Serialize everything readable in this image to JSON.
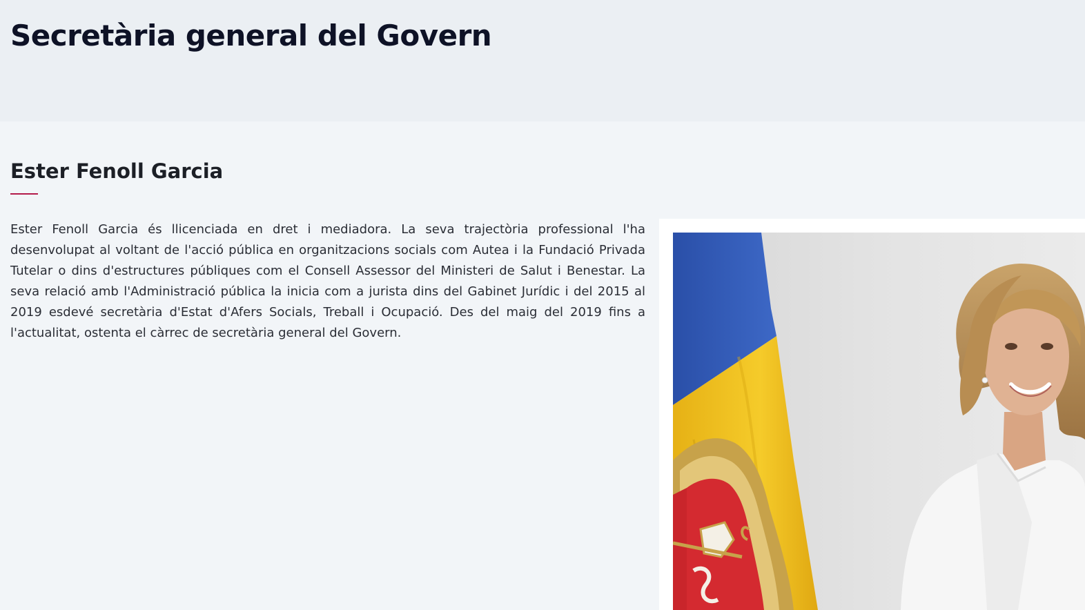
{
  "header": {
    "title": "Secretària general del Govern"
  },
  "profile": {
    "name": "Ester Fenoll Garcia",
    "bio": "Ester Fenoll Garcia és llicenciada en dret i mediadora. La seva trajectòria professional l'ha desenvolupat al voltant de l'acció pública en organitzacions socials com Autea i la Fundació Privada Tutelar o dins d'estructures públiques com el Consell Assessor del Ministeri de Salut i Benestar. La seva relació amb l'Administració pública la inicia com a jurista dins del Gabinet Jurídic i del 2015 al 2019 esdevé secretària d'Estat d'Afers Socials, Treball i Ocupació. Des del maig del 2019 fins a l'actualitat, ostenta el càrrec de secretària general del Govern.",
    "accent_color": "#b3194a"
  },
  "photo": {
    "subject": "portrait-with-andorra-flag",
    "flag_colors": [
      "#2d57b8",
      "#f1c21c",
      "#d21f2e"
    ]
  }
}
